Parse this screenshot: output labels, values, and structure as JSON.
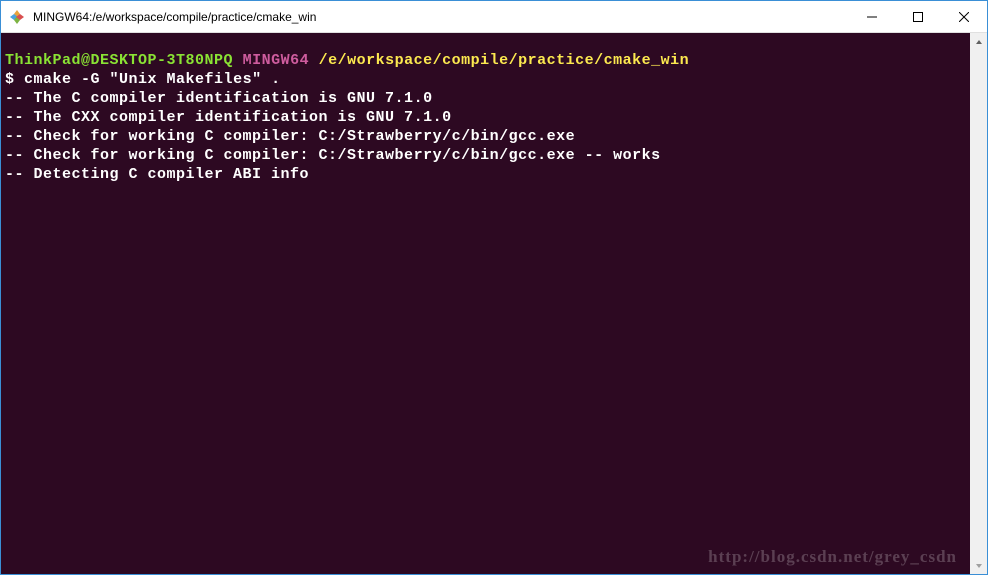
{
  "window": {
    "title": "MINGW64:/e/workspace/compile/practice/cmake_win"
  },
  "prompt": {
    "user_host": "ThinkPad@DESKTOP-3T80NPQ",
    "env": "MINGW64",
    "path": "/e/workspace/compile/practice/cmake_win",
    "symbol": "$",
    "command": "cmake -G \"Unix Makefiles\" ."
  },
  "output": {
    "l1": "-- The C compiler identification is GNU 7.1.0",
    "l2": "-- The CXX compiler identification is GNU 7.1.0",
    "l3": "-- Check for working C compiler: C:/Strawberry/c/bin/gcc.exe",
    "l4": "-- Check for working C compiler: C:/Strawberry/c/bin/gcc.exe -- works",
    "l5": "-- Detecting C compiler ABI info"
  },
  "watermark": "http://blog.csdn.net/grey_csdn"
}
